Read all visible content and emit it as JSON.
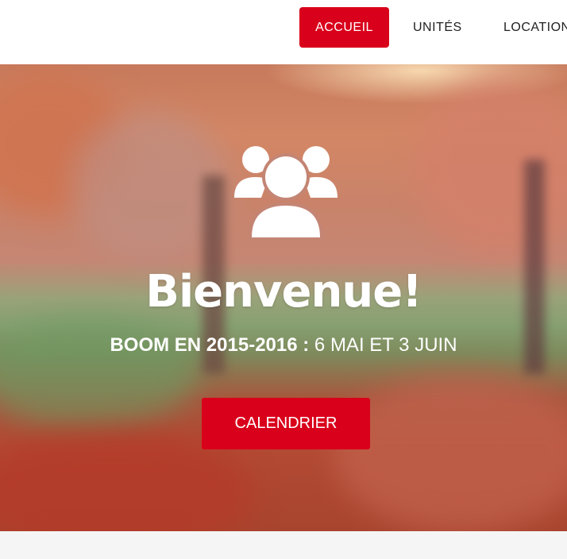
{
  "nav": {
    "items": [
      {
        "label": "ACCUEIL",
        "active": true
      },
      {
        "label": "UNITÉS",
        "active": false
      },
      {
        "label": "LOCATION",
        "active": false
      }
    ]
  },
  "hero": {
    "icon": "users-group-icon",
    "title": "Bienvenue!",
    "subtitle_strong": "BOOM EN 2015-2016 :",
    "subtitle_rest": "6 MAI ET 3 JUIN",
    "cta_label": "CALENDRIER"
  },
  "colors": {
    "accent": "#d9001b",
    "nav_background": "#ffffff",
    "text_on_accent": "#ffffff",
    "footer_background": "#f5f5f5"
  }
}
